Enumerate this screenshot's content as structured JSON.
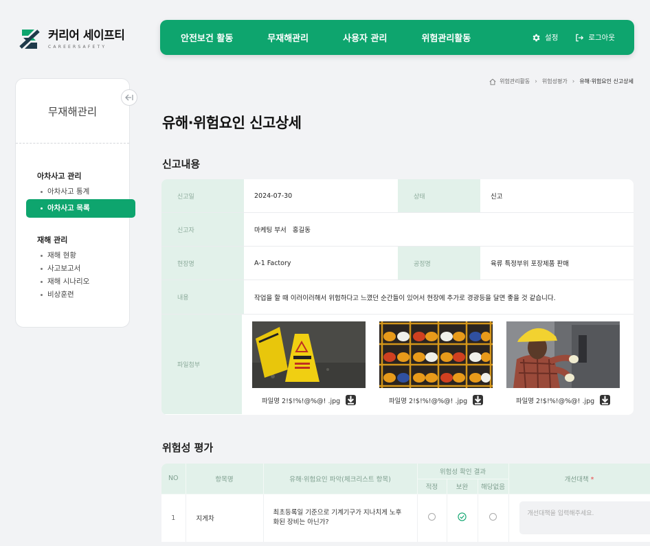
{
  "logo": {
    "title": "커리어 세이프티",
    "subtitle": "CAREERSAFETY"
  },
  "topnav": {
    "items": [
      "안전보건 활동",
      "무재해관리",
      "사용자 관리",
      "위험관리활동"
    ],
    "settings": "설정",
    "logout": "로그아웃"
  },
  "sidebar": {
    "title": "무재해관리",
    "groups": [
      {
        "label": "아차사고 관리",
        "items": [
          "아차사고 통계",
          "아차사고 목록"
        ]
      },
      {
        "label": "재해 관리",
        "items": [
          "재해 현황",
          "사고보고서",
          "재해 시나리오",
          "비상훈련"
        ]
      }
    ]
  },
  "breadcrumb": [
    "위험관리활동",
    "위험성평가",
    "유해·위험요인 신고상세"
  ],
  "page_title": "유해·위험요인 신고상세",
  "report": {
    "section_title": "신고내용",
    "labels": {
      "date": "신고일",
      "status": "상태",
      "reporter": "신고자",
      "site": "현장명",
      "process": "공정명",
      "content": "내용",
      "attachment": "파일첨부"
    },
    "date": "2024-07-30",
    "status": "신고",
    "reporter": "마케팅 부서   홍길동",
    "site": "A-1 Factory",
    "process": "육류 특정부위 포장제품 판매",
    "content": "작업을 할 때 이러이러해서 위험하다고 느꼈던 순간들이 있어서 현장에 추가로 경광등을 달면 좋을 것 같습니다.",
    "files": [
      {
        "name": "파일명 2!$!%!@%@! .jpg",
        "icon": "download-icon"
      },
      {
        "name": "파일명 2!$!%!@%@! .jpg",
        "icon": "download-icon"
      },
      {
        "name": "파일명 2!$!%!@%@! .jpg",
        "icon": "download-icon"
      }
    ]
  },
  "risk": {
    "section_title": "위험성 평가",
    "headers": {
      "no": "NO",
      "item": "항목명",
      "factor": "유해·위험요인 파악(체크리스트 항목)",
      "result": "위험성 확인 결과",
      "ok": "적정",
      "supplement": "보완",
      "na": "해당없음",
      "improve": "개선대책",
      "required": "*"
    },
    "rows": [
      {
        "no": "1",
        "item": "지게차",
        "factor": "최초등록일 기준으로 기계기구가 지나치게 노후화된 장비는 아닌가?",
        "selected": "supplement",
        "improve_placeholder": "개선대책을 입력해주세요."
      }
    ]
  },
  "colors": {
    "brand": "#0ea56e",
    "label_bg": "#e2f1ea"
  }
}
